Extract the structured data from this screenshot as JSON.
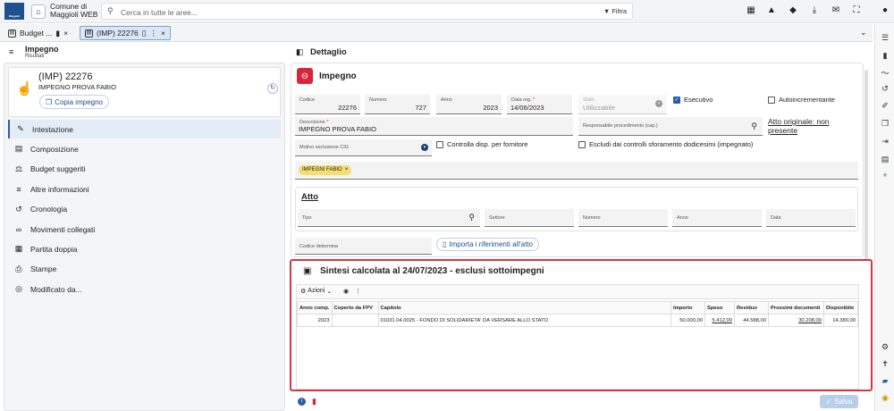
{
  "topbar": {
    "logo_text": "Maggioli",
    "org_line1": "Comune di",
    "org_line2": "Maggioli WEB",
    "search_placeholder": "Cerca in tutte le aree...",
    "filter_label": "Filtra",
    "icons": [
      "apps-icon",
      "warning-icon",
      "bell-icon",
      "download-icon",
      "mail-icon",
      "expand-icon",
      "user-icon"
    ]
  },
  "tabs": [
    {
      "label": "Budget ...",
      "active": false
    },
    {
      "label": "(IMP) 22276",
      "active": true
    }
  ],
  "left": {
    "header_title": "Impegno",
    "header_sub": "Risultati",
    "card_title": "(IMP) 22276",
    "card_subtitle": "IMPEGNO PROVA FABIO",
    "copy_button": "Copia impegno",
    "menu": [
      {
        "label": "Intestazione",
        "icon": "pencil-icon",
        "glyph": "✎",
        "active": true
      },
      {
        "label": "Composizione",
        "icon": "layers-icon",
        "glyph": "▤",
        "active": false
      },
      {
        "label": "Budget suggeriti",
        "icon": "balance-icon",
        "glyph": "⚖",
        "active": false
      },
      {
        "label": "Altre informazioni",
        "icon": "list-icon",
        "glyph": "≡",
        "active": false
      },
      {
        "label": "Cronologia",
        "icon": "history-icon",
        "glyph": "↺",
        "active": false
      },
      {
        "label": "Movimenti collegati",
        "icon": "link-icon",
        "glyph": "∞",
        "active": false
      },
      {
        "label": "Partita doppia",
        "icon": "grid-icon",
        "glyph": "▦",
        "active": false
      },
      {
        "label": "Stampe",
        "icon": "print-icon",
        "glyph": "⎙",
        "active": false
      },
      {
        "label": "Modificato da...",
        "icon": "fingerprint-icon",
        "glyph": "◎",
        "active": false
      }
    ]
  },
  "right": {
    "header_title": "Dettaglio",
    "section_title": "Impegno",
    "fields": {
      "codice": {
        "label": "Codice",
        "value": "22276"
      },
      "numero": {
        "label": "Numero",
        "value": "727"
      },
      "anno": {
        "label": "Anno",
        "value": "2023"
      },
      "data_reg": {
        "label": "Data reg.",
        "value": "14/06/2023"
      },
      "stato": {
        "label": "Stato",
        "value": "Utilizzabile"
      },
      "esecutivo": {
        "label": "Esecutivo",
        "checked": true
      },
      "autoincrementante": {
        "label": "Autoincrementante",
        "checked": false
      },
      "descrizione": {
        "label": "Descrizione",
        "value": "IMPEGNO PROVA FABIO"
      },
      "responsabile": {
        "label": "Responsabile procedimento (cap.)",
        "value": ""
      },
      "atto_originale": "Atto originale: non presente",
      "motivo": {
        "label": "Motivo esclusione CIG",
        "value": ""
      },
      "controlla_disp": {
        "label": "Controlla disp. per fornitore",
        "checked": false
      },
      "escludi": {
        "label": "Escludi dai controlli sforamento dodicesimi (impegnato)",
        "checked": false
      }
    },
    "chip": "IMPEGNI FABIO",
    "atto": {
      "title": "Atto",
      "fields": [
        "Tipo",
        "Settore",
        "Numero",
        "Anno",
        "Data"
      ]
    },
    "codice_determina": "Codice determina",
    "importa_button": "Importa i riferimenti all'atto"
  },
  "sintesi": {
    "title": "Sintesi calcolata al 24/07/2023 - esclusi sottoimpegni",
    "azioni_label": "Azioni",
    "columns": [
      "Anno comp.",
      "Coperto da FPV",
      "Capitolo",
      "Importo",
      "Speso",
      "Residuo",
      "Prossimi documenti",
      "Disponibile"
    ],
    "rows": [
      [
        "2023",
        "",
        "01031.04.0025 - FONDO DI SOLIDARIETA' DA VERSARE ALLO STATO",
        "50.000,00",
        "5.412,00",
        "44.588,00",
        "30.208,00",
        "14.380,00"
      ]
    ]
  },
  "footer": {
    "save_label": "Salva"
  }
}
